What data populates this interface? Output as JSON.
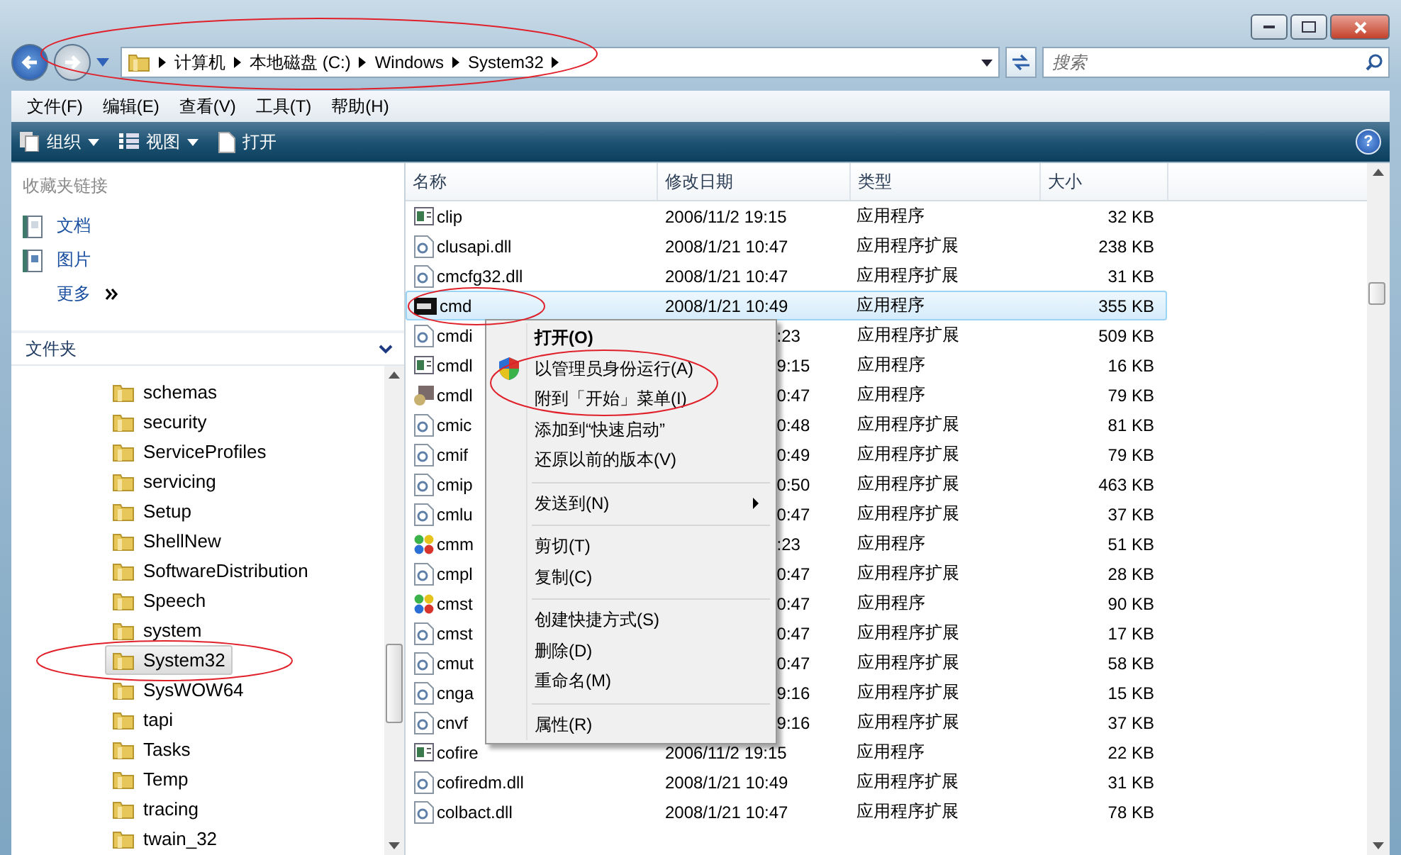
{
  "address": {
    "crumbs": [
      "计算机",
      "本地磁盘 (C:)",
      "Windows",
      "System32"
    ]
  },
  "search": {
    "placeholder": "搜索"
  },
  "menu_bar": [
    "文件(F)",
    "编辑(E)",
    "查看(V)",
    "工具(T)",
    "帮助(H)"
  ],
  "toolbar": {
    "buttons": [
      {
        "label": "组织",
        "dropdown": true
      },
      {
        "label": "视图",
        "dropdown": true
      },
      {
        "label": "打开",
        "dropdown": false
      }
    ],
    "help": "?"
  },
  "favorites": {
    "title": "收藏夹链接",
    "items": [
      "文档",
      "图片"
    ],
    "more": "更多"
  },
  "folders": {
    "title": "文件夹",
    "items": [
      {
        "label": "schemas",
        "selected": false
      },
      {
        "label": "security",
        "selected": false
      },
      {
        "label": "ServiceProfiles",
        "selected": false
      },
      {
        "label": "servicing",
        "selected": false
      },
      {
        "label": "Setup",
        "selected": false
      },
      {
        "label": "ShellNew",
        "selected": false
      },
      {
        "label": "SoftwareDistribution",
        "selected": false
      },
      {
        "label": "Speech",
        "selected": false
      },
      {
        "label": "system",
        "selected": false
      },
      {
        "label": "System32",
        "selected": true
      },
      {
        "label": "SysWOW64",
        "selected": false
      },
      {
        "label": "tapi",
        "selected": false
      },
      {
        "label": "Tasks",
        "selected": false
      },
      {
        "label": "Temp",
        "selected": false
      },
      {
        "label": "tracing",
        "selected": false
      },
      {
        "label": "twain_32",
        "selected": false
      }
    ]
  },
  "table": {
    "columns": [
      "名称",
      "修改日期",
      "类型",
      "大小"
    ],
    "rows": [
      {
        "name": "clip",
        "date": "2006/11/2 19:15",
        "type": "应用程序",
        "size": "32 KB",
        "kind": "window",
        "selected": false,
        "covered": false
      },
      {
        "name": "clusapi.dll",
        "date": "2008/1/21 10:47",
        "type": "应用程序扩展",
        "size": "238 KB",
        "kind": "dll",
        "selected": false,
        "covered": false
      },
      {
        "name": "cmcfg32.dll",
        "date": "2008/1/21 10:47",
        "type": "应用程序扩展",
        "size": "31 KB",
        "kind": "dll",
        "selected": false,
        "covered": false
      },
      {
        "name": "cmd",
        "date": "2008/1/21 10:49",
        "type": "应用程序",
        "size": "355 KB",
        "kind": "console",
        "selected": true,
        "covered": false
      },
      {
        "name": "cmdi",
        "date": ":23",
        "type": "应用程序扩展",
        "size": "509 KB",
        "kind": "dll",
        "selected": false,
        "covered": true
      },
      {
        "name": "cmdl",
        "date": "9:15",
        "type": "应用程序",
        "size": "16 KB",
        "kind": "window",
        "selected": false,
        "covered": true
      },
      {
        "name": "cmdl",
        "date": "0:47",
        "type": "应用程序",
        "size": "79 KB",
        "kind": "tool",
        "selected": false,
        "covered": true
      },
      {
        "name": "cmic",
        "date": "0:48",
        "type": "应用程序扩展",
        "size": "81 KB",
        "kind": "dll",
        "selected": false,
        "covered": true
      },
      {
        "name": "cmif",
        "date": "0:49",
        "type": "应用程序扩展",
        "size": "79 KB",
        "kind": "dll",
        "selected": false,
        "covered": true
      },
      {
        "name": "cmip",
        "date": "0:50",
        "type": "应用程序扩展",
        "size": "463 KB",
        "kind": "dll",
        "selected": false,
        "covered": true
      },
      {
        "name": "cmlu",
        "date": "0:47",
        "type": "应用程序扩展",
        "size": "37 KB",
        "kind": "dll",
        "selected": false,
        "covered": true
      },
      {
        "name": "cmm",
        "date": ":23",
        "type": "应用程序",
        "size": "51 KB",
        "kind": "colorful",
        "selected": false,
        "covered": true
      },
      {
        "name": "cmpl",
        "date": "0:47",
        "type": "应用程序扩展",
        "size": "28 KB",
        "kind": "dll",
        "selected": false,
        "covered": true
      },
      {
        "name": "cmst",
        "date": "0:47",
        "type": "应用程序",
        "size": "90 KB",
        "kind": "colorful",
        "selected": false,
        "covered": true
      },
      {
        "name": "cmst",
        "date": "0:47",
        "type": "应用程序扩展",
        "size": "17 KB",
        "kind": "dll",
        "selected": false,
        "covered": true
      },
      {
        "name": "cmut",
        "date": "0:47",
        "type": "应用程序扩展",
        "size": "58 KB",
        "kind": "dll",
        "selected": false,
        "covered": true
      },
      {
        "name": "cnga",
        "date": "9:16",
        "type": "应用程序扩展",
        "size": "15 KB",
        "kind": "dll",
        "selected": false,
        "covered": true
      },
      {
        "name": "cnvf",
        "date": "9:16",
        "type": "应用程序扩展",
        "size": "37 KB",
        "kind": "dll",
        "selected": false,
        "covered": true
      },
      {
        "name": "cofire",
        "date": "2006/11/2 19:15",
        "type": "应用程序",
        "size": "22 KB",
        "kind": "window",
        "selected": false,
        "covered": false
      },
      {
        "name": "cofiredm.dll",
        "date": "2008/1/21 10:49",
        "type": "应用程序扩展",
        "size": "31 KB",
        "kind": "dll",
        "selected": false,
        "covered": false
      },
      {
        "name": "colbact.dll",
        "date": "2008/1/21 10:47",
        "type": "应用程序扩展",
        "size": "78 KB",
        "kind": "dll",
        "selected": false,
        "covered": false
      }
    ]
  },
  "context_menu": [
    {
      "kind": "default",
      "label": "打开(O)"
    },
    {
      "kind": "admin",
      "label": "以管理员身份运行(A)"
    },
    {
      "kind": "item",
      "label": "附到「开始」菜单(I)"
    },
    {
      "kind": "item",
      "label": "添加到“快速启动”"
    },
    {
      "kind": "item",
      "label": "还原以前的版本(V)"
    },
    {
      "kind": "separator"
    },
    {
      "kind": "submenu",
      "label": "发送到(N)"
    },
    {
      "kind": "separator"
    },
    {
      "kind": "item",
      "label": "剪切(T)"
    },
    {
      "kind": "item",
      "label": "复制(C)"
    },
    {
      "kind": "separator"
    },
    {
      "kind": "item",
      "label": "创建快捷方式(S)"
    },
    {
      "kind": "item",
      "label": "删除(D)"
    },
    {
      "kind": "item",
      "label": "重命名(M)"
    },
    {
      "kind": "separator"
    },
    {
      "kind": "item",
      "label": "属性(R)"
    }
  ]
}
